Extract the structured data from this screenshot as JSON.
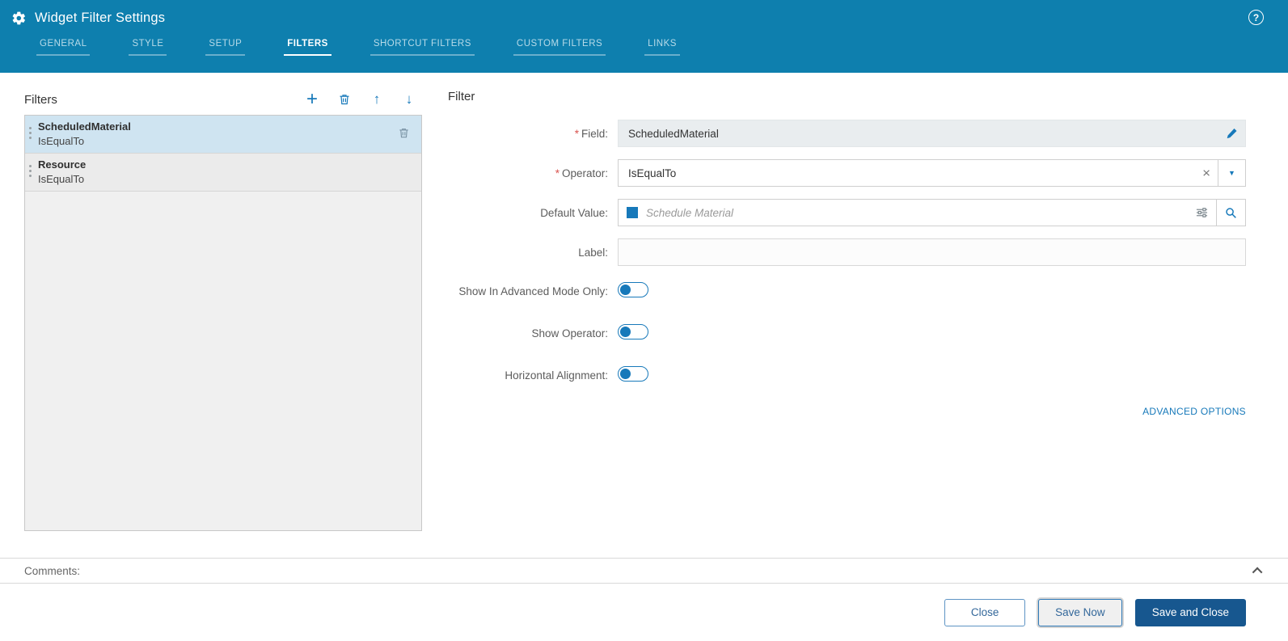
{
  "header": {
    "title": "Widget Filter Settings",
    "tabs": [
      {
        "label": "GENERAL"
      },
      {
        "label": "STYLE"
      },
      {
        "label": "SETUP"
      },
      {
        "label": "FILTERS"
      },
      {
        "label": "SHORTCUT FILTERS"
      },
      {
        "label": "CUSTOM FILTERS"
      },
      {
        "label": "LINKS"
      }
    ],
    "active_tab": "FILTERS"
  },
  "filters_panel": {
    "title": "Filters",
    "items": [
      {
        "field": "ScheduledMaterial",
        "operator": "IsEqualTo",
        "selected": true
      },
      {
        "field": "Resource",
        "operator": "IsEqualTo",
        "selected": false
      }
    ]
  },
  "filter_form": {
    "title": "Filter",
    "field": {
      "label": "Field:",
      "value": "ScheduledMaterial",
      "required": true
    },
    "operator": {
      "label": "Operator:",
      "value": "IsEqualTo",
      "required": true
    },
    "default_value": {
      "label": "Default Value:",
      "value": "",
      "placeholder": "Schedule Material"
    },
    "label_input": {
      "label": "Label:",
      "value": ""
    },
    "toggles": [
      {
        "label": "Show In Advanced Mode Only:",
        "state": "off"
      },
      {
        "label": "Show Operator:",
        "state": "off"
      },
      {
        "label": "Horizontal Alignment:",
        "state": "off"
      }
    ],
    "advanced_options": "ADVANCED OPTIONS"
  },
  "footer": {
    "comments_label": "Comments:",
    "buttons": [
      {
        "label": "Close"
      },
      {
        "label": "Save Now"
      },
      {
        "label": "Save and Close"
      }
    ]
  },
  "icons": {
    "help": "?",
    "add": "+",
    "move_up": "↑",
    "move_down": "↓",
    "clear": "×",
    "dropdown": "▼",
    "required": "*"
  },
  "colors": {
    "header_bg": "#0e7fae",
    "accent": "#1779ba",
    "primary_button_bg": "#17578f",
    "selected_item_bg": "#cfe4f1"
  }
}
